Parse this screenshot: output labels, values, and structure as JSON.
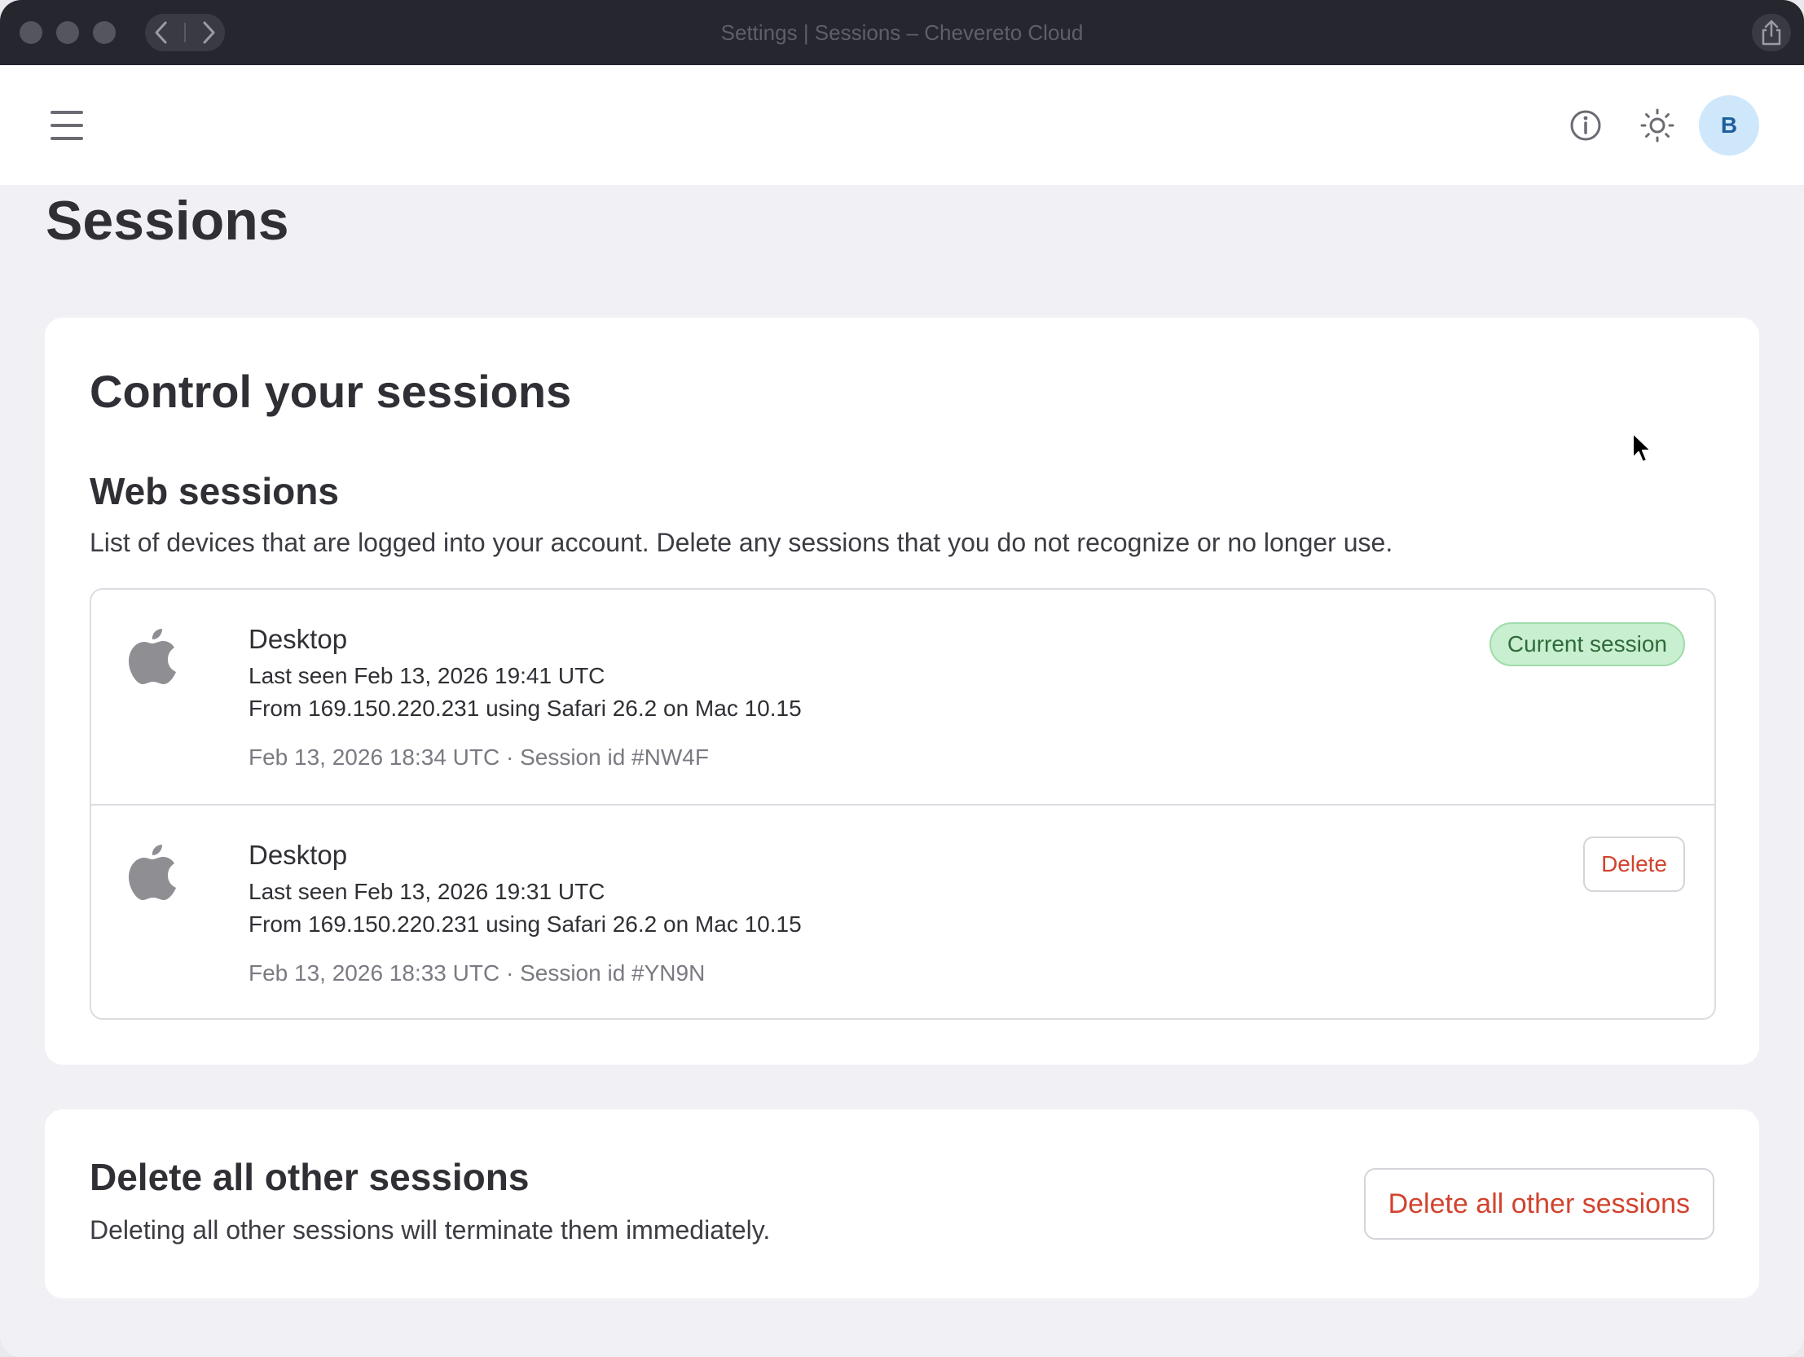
{
  "window": {
    "title": "Settings | Sessions – Chevereto Cloud"
  },
  "header": {
    "avatar_initial": "B"
  },
  "page": {
    "title": "Sessions"
  },
  "sessions_card": {
    "title": "Control your sessions",
    "section_title": "Web sessions",
    "section_desc": "List of devices that are logged into your account. Delete any sessions that you do not recognize or no longer use.",
    "sessions": [
      {
        "device": "Desktop",
        "last_seen": "Last seen Feb 13, 2026 19:41 UTC",
        "from": "From 169.150.220.231 using Safari 26.2 on Mac 10.15",
        "meta": "Feb 13, 2026 18:34 UTC · Session id #NW4F",
        "badge": "Current session"
      },
      {
        "device": "Desktop",
        "last_seen": "Last seen Feb 13, 2026 19:31 UTC",
        "from": "From 169.150.220.231 using Safari 26.2 on Mac 10.15",
        "meta": "Feb 13, 2026 18:33 UTC · Session id #YN9N",
        "action": "Delete"
      }
    ]
  },
  "delete_all_card": {
    "title": "Delete all other sessions",
    "desc": "Deleting all other sessions will terminate them immediately.",
    "button": "Delete all other sessions"
  },
  "colors": {
    "accent_danger": "#d2432e",
    "badge_bg": "#c8efcf",
    "avatar_bg": "#cfe7fb"
  },
  "icons": {
    "menu": "hamburger-icon",
    "info": "info-icon",
    "theme": "sun-icon",
    "device": "apple-icon"
  }
}
